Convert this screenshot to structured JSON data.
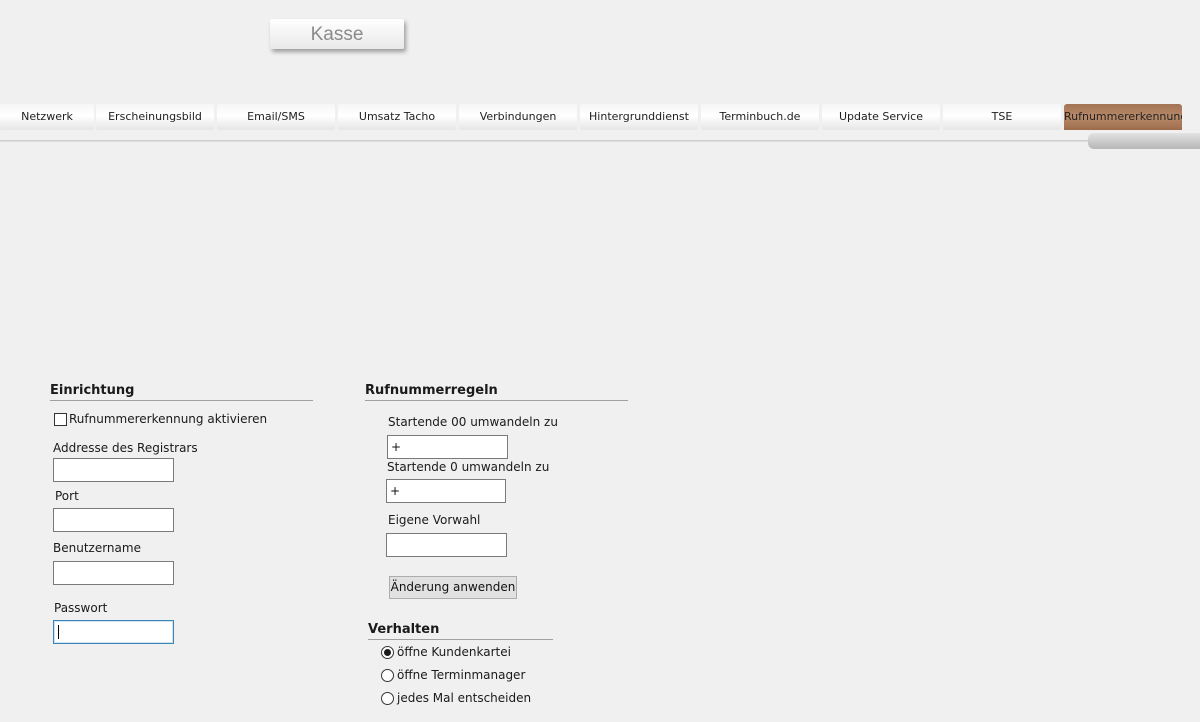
{
  "header": {
    "title": "Kasse"
  },
  "tabs": [
    {
      "label": "Netzwerk"
    },
    {
      "label": "Erscheinungsbild"
    },
    {
      "label": "Email/SMS"
    },
    {
      "label": "Umsatz Tacho"
    },
    {
      "label": "Verbindungen"
    },
    {
      "label": "Hintergrunddienst"
    },
    {
      "label": "Terminbuch.de"
    },
    {
      "label": "Update Service"
    },
    {
      "label": "TSE"
    },
    {
      "label": "Rufnummererkennung",
      "active": true
    }
  ],
  "einrichtung": {
    "heading": "Einrichtung",
    "activate_label": "Rufnummererkennung aktivieren",
    "activate_checked": false,
    "registrar_label": "Addresse des Registrars",
    "registrar_value": "",
    "port_label": "Port",
    "port_value": "",
    "username_label": "Benutzername",
    "username_value": "",
    "password_label": "Passwort",
    "password_value": ""
  },
  "rules": {
    "heading": "Rufnummerregeln",
    "rule00_label": "Startende 00 umwandeln zu",
    "rule00_value": "+",
    "rule0_label": "Startende 0 umwandeln zu",
    "rule0_value": "+",
    "area_label": "Eigene Vorwahl",
    "area_value": "",
    "apply_button": "Änderung anwenden"
  },
  "verhalten": {
    "heading": "Verhalten",
    "options": [
      {
        "label": "öffne Kundenkartei",
        "selected": true
      },
      {
        "label": "öffne Terminmanager",
        "selected": false
      },
      {
        "label": "jedes Mal entscheiden",
        "selected": false
      }
    ]
  },
  "colors": {
    "background": "#f0f0f0",
    "active_tab": "#a27455",
    "focus_border": "#3a84b8"
  }
}
